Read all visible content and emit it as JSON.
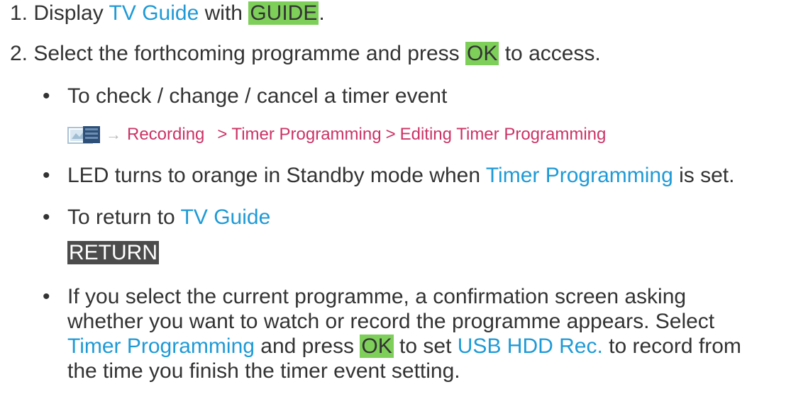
{
  "steps": [
    {
      "num": "1.",
      "text_a": "Display ",
      "link": "TV Guide",
      "text_b": " with ",
      "key": "GUIDE",
      "text_c": "."
    },
    {
      "num": "2.",
      "text_a": "Select the forthcoming programme and press ",
      "key": "OK",
      "text_b": " to access."
    }
  ],
  "bullets": {
    "b1": {
      "text": "To check / change / cancel a timer event"
    },
    "breadcrumb": {
      "icon": "menu-screen-icon",
      "arrow": "→",
      "item1": "Recording",
      "sep": ">",
      "item2": "Timer Programming",
      "item3": "Editing Timer Programming"
    },
    "b2": {
      "text_a": "LED turns to orange in Standby mode when ",
      "link": "Timer Programming",
      "text_b": " is set."
    },
    "b3": {
      "text_a": "To return to ",
      "link": "TV Guide",
      "key": "RETURN"
    },
    "b4": {
      "line1": "If you select the current programme, a confirmation screen asking",
      "line2": "whether you want to watch or record the programme appears. Select",
      "link1": "Timer Programming",
      "text_mid1": " and press ",
      "key": "OK",
      "text_mid2": " to set ",
      "link2": "USB HDD Rec.",
      "text_end": " to record from",
      "line4": "the time you finish the timer event setting."
    }
  },
  "bullet_char": "•",
  "colors": {
    "text": "#333333",
    "link": "#1f9ad6",
    "breadcrumb": "#cc3366",
    "key_green": "#7ecf5a",
    "key_gray": "#4c4c4c"
  }
}
